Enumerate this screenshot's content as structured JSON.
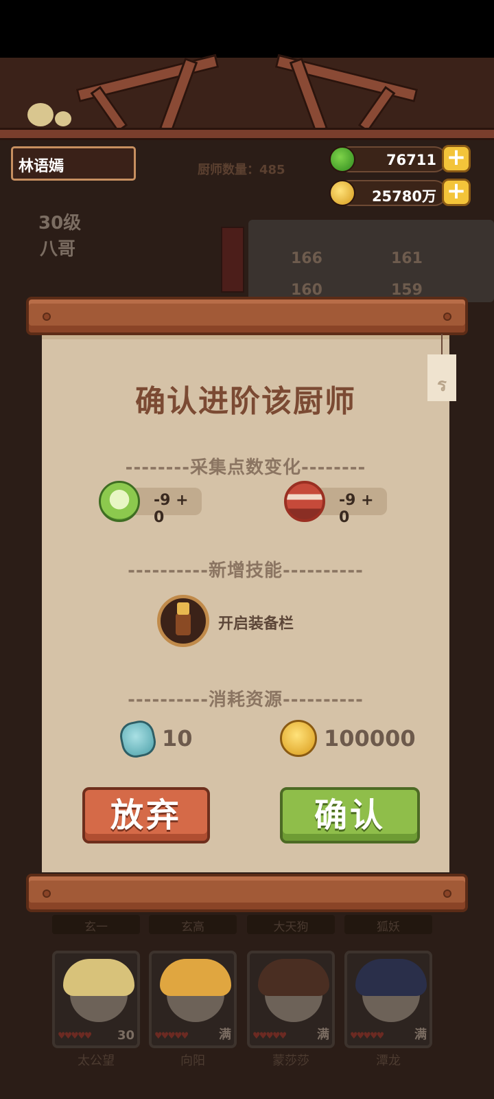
{
  "header": {
    "player_name": "林语嫣",
    "chef_count": "厨师数量：485",
    "jade": "76711",
    "coins": "25780万"
  },
  "background_chef": {
    "level": "30级",
    "name": "八哥",
    "side_tab": "技法",
    "stats": [
      {
        "icon": "炒",
        "value": "166"
      },
      {
        "icon": "炸",
        "value": "161"
      },
      {
        "icon": "切",
        "value": "160"
      },
      {
        "icon": "蒸",
        "value": "159"
      }
    ]
  },
  "dialog": {
    "title": "确认进阶该厨师",
    "collect_section": "--------采集点数变化--------",
    "veg_change": "-9 + 0",
    "meat_change": "-9 + 0",
    "skill_section": "----------新增技能----------",
    "skill_label": "开启装备栏",
    "cost_section": "----------消耗资源----------",
    "cost_stone": "10",
    "cost_coins": "100000",
    "cancel_label": "放弃",
    "confirm_label": "确认"
  },
  "chef_grid": {
    "top_labels": [
      "玄一",
      "玄高",
      "大天狗",
      "狐妖"
    ],
    "chefs": [
      {
        "name": "太公望",
        "badge": "30",
        "hair_color": "#d8c27a"
      },
      {
        "name": "向阳",
        "badge": "满",
        "hair_color": "#e0a640"
      },
      {
        "name": "蒙莎莎",
        "badge": "满",
        "hair_color": "#4a2e22"
      },
      {
        "name": "潭龙",
        "badge": "满",
        "hair_color": "#2a2f4a"
      }
    ]
  }
}
